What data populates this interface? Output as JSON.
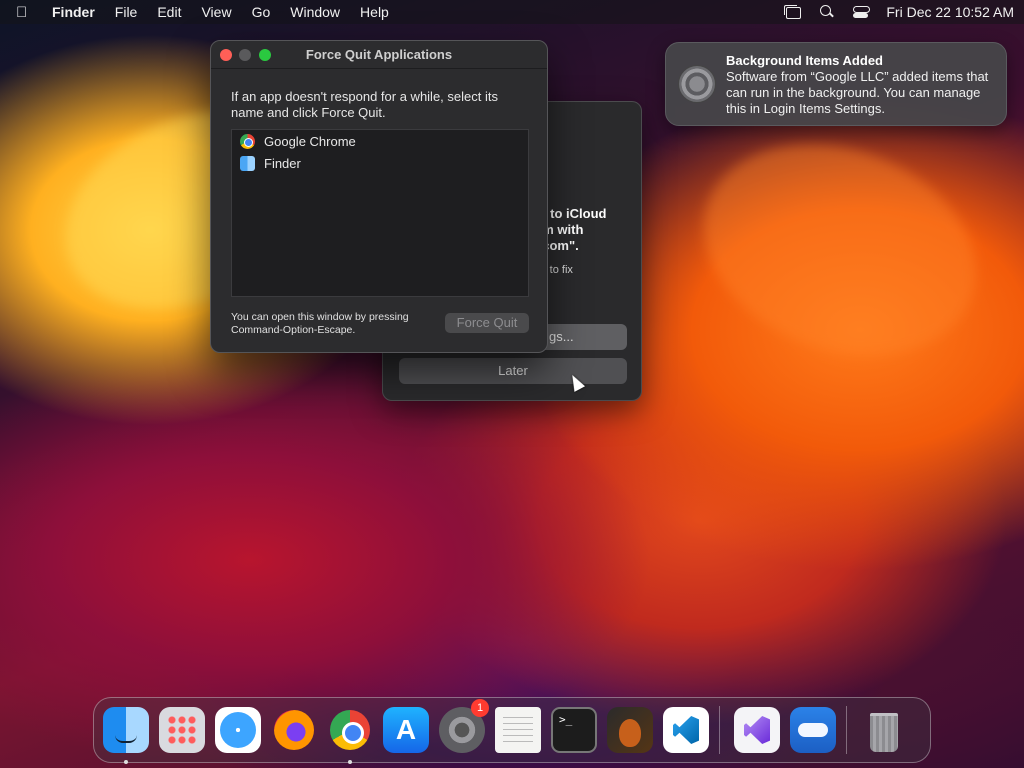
{
  "menubar": {
    "app_name": "Finder",
    "menus": [
      "File",
      "Edit",
      "View",
      "Go",
      "Window",
      "Help"
    ],
    "clock": "Fri Dec 22  10:52 AM"
  },
  "icloud_dialog": {
    "message": "ct to iCloud\nem with\nl.com\".",
    "submessage": "gs to fix",
    "settings_button": "gs...",
    "later_button": "Later"
  },
  "force_quit": {
    "title": "Force Quit Applications",
    "instructions": "If an app doesn't respond for a while, select its name and click Force Quit.",
    "apps": [
      {
        "name": "Google Chrome",
        "icon": "chrome-icon"
      },
      {
        "name": "Finder",
        "icon": "finder-icon"
      }
    ],
    "hint": "You can open this window by pressing Command-Option-Escape.",
    "button": "Force Quit"
  },
  "notification": {
    "title": "Background Items Added",
    "body": "Software from “Google LLC” added items that can run in the background. You can manage this in Login Items Settings.",
    "icon": "system-settings-icon"
  },
  "dock": {
    "items": [
      {
        "name": "finder",
        "icon": "finder-icon",
        "running": true
      },
      {
        "name": "launchpad",
        "icon": "launchpad-icon",
        "running": false
      },
      {
        "name": "safari",
        "icon": "safari-icon",
        "running": false
      },
      {
        "name": "firefox",
        "icon": "firefox-icon",
        "running": false
      },
      {
        "name": "chrome",
        "icon": "chrome-icon",
        "running": true
      },
      {
        "name": "app-store",
        "icon": "app-store-icon",
        "running": false
      },
      {
        "name": "system-settings",
        "icon": "system-settings-icon",
        "running": false,
        "badge": "1"
      },
      {
        "name": "textedit",
        "icon": "textedit-icon",
        "running": false
      },
      {
        "name": "terminal",
        "icon": "terminal-icon",
        "running": false
      },
      {
        "name": "garageband",
        "icon": "garageband-icon",
        "running": false
      },
      {
        "name": "vscode",
        "icon": "vscode-icon",
        "running": false
      },
      {
        "name": "visual-studio",
        "icon": "visual-studio-icon",
        "running": false
      },
      {
        "name": "weather",
        "icon": "weather-icon",
        "running": false
      },
      {
        "name": "trash",
        "icon": "trash-icon",
        "running": false
      }
    ]
  }
}
